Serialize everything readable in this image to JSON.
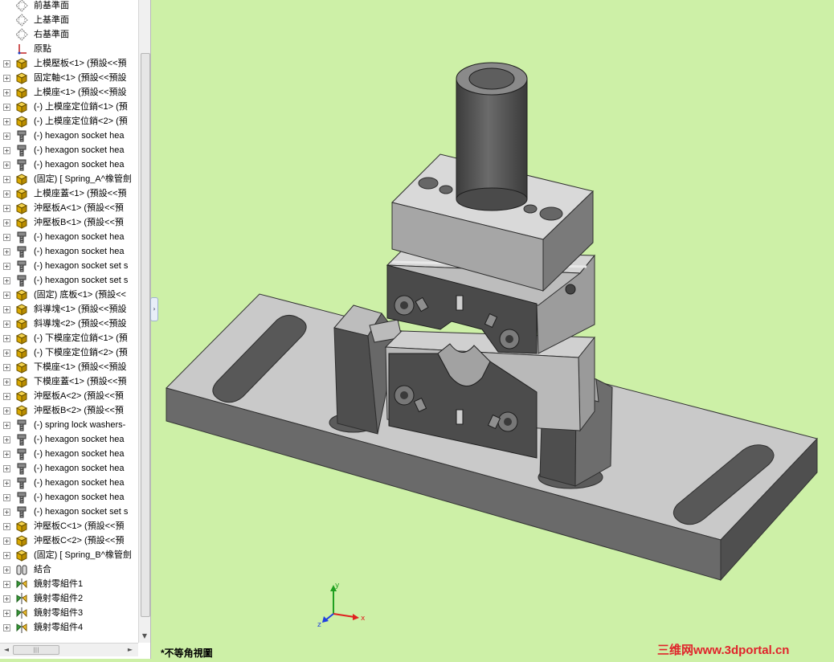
{
  "tree": {
    "items": [
      {
        "icon": "plane-icon",
        "label": "前基準面",
        "expandable": false
      },
      {
        "icon": "plane-icon",
        "label": "上基準面",
        "expandable": false
      },
      {
        "icon": "plane-icon",
        "label": "右基準面",
        "expandable": false
      },
      {
        "icon": "origin-icon",
        "label": "原點",
        "expandable": false
      },
      {
        "icon": "part-icon",
        "label": "上模壓板<1> (預設<<預",
        "expandable": true
      },
      {
        "icon": "part-icon",
        "label": "固定軸<1> (預設<<預設",
        "expandable": true
      },
      {
        "icon": "part-icon",
        "label": "上模座<1> (預設<<預設",
        "expandable": true
      },
      {
        "icon": "part-icon",
        "label": "(-) 上模座定位銷<1> (預",
        "expandable": true
      },
      {
        "icon": "part-icon",
        "label": "(-) 上模座定位銷<2> (預",
        "expandable": true
      },
      {
        "icon": "screw-icon",
        "label": "(-) hexagon socket hea",
        "expandable": true
      },
      {
        "icon": "screw-icon",
        "label": "(-) hexagon socket hea",
        "expandable": true
      },
      {
        "icon": "screw-icon",
        "label": "(-) hexagon socket hea",
        "expandable": true
      },
      {
        "icon": "part-icon",
        "label": "(固定) [ Spring_A^橡管劍",
        "expandable": true
      },
      {
        "icon": "part-icon",
        "label": "上模座蓋<1> (預設<<預",
        "expandable": true
      },
      {
        "icon": "part-icon",
        "label": "沖壓板A<1> (預設<<預",
        "expandable": true
      },
      {
        "icon": "part-icon",
        "label": "沖壓板B<1> (預設<<預",
        "expandable": true
      },
      {
        "icon": "screw-icon",
        "label": "(-) hexagon socket hea",
        "expandable": true
      },
      {
        "icon": "screw-icon",
        "label": "(-) hexagon socket hea",
        "expandable": true
      },
      {
        "icon": "screw-icon",
        "label": "(-) hexagon socket set s",
        "expandable": true
      },
      {
        "icon": "screw-icon",
        "label": "(-) hexagon socket set s",
        "expandable": true
      },
      {
        "icon": "part-icon",
        "label": "(固定) 底板<1> (預設<<",
        "expandable": true
      },
      {
        "icon": "part-icon",
        "label": "斜導塊<1> (預設<<預設",
        "expandable": true
      },
      {
        "icon": "part-icon",
        "label": "斜導塊<2> (預設<<預設",
        "expandable": true
      },
      {
        "icon": "part-icon",
        "label": "(-) 下模座定位銷<1> (預",
        "expandable": true
      },
      {
        "icon": "part-icon",
        "label": "(-) 下模座定位銷<2> (預",
        "expandable": true
      },
      {
        "icon": "part-icon",
        "label": "下模座<1> (預設<<預設",
        "expandable": true
      },
      {
        "icon": "part-icon",
        "label": "下模座蓋<1> (預設<<預",
        "expandable": true
      },
      {
        "icon": "part-icon",
        "label": "沖壓板A<2> (預設<<預",
        "expandable": true
      },
      {
        "icon": "part-icon",
        "label": "沖壓板B<2> (預設<<預",
        "expandable": true
      },
      {
        "icon": "screw-icon",
        "label": "(-) spring lock washers-",
        "expandable": true
      },
      {
        "icon": "screw-icon",
        "label": "(-) hexagon socket hea",
        "expandable": true
      },
      {
        "icon": "screw-icon",
        "label": "(-) hexagon socket hea",
        "expandable": true
      },
      {
        "icon": "screw-icon",
        "label": "(-) hexagon socket hea",
        "expandable": true
      },
      {
        "icon": "screw-icon",
        "label": "(-) hexagon socket hea",
        "expandable": true
      },
      {
        "icon": "screw-icon",
        "label": "(-) hexagon socket hea",
        "expandable": true
      },
      {
        "icon": "screw-icon",
        "label": "(-) hexagon socket set s",
        "expandable": true
      },
      {
        "icon": "part-icon",
        "label": "沖壓板C<1> (預設<<預",
        "expandable": true
      },
      {
        "icon": "part-icon",
        "label": "沖壓板C<2> (預設<<預",
        "expandable": true
      },
      {
        "icon": "part-icon",
        "label": "(固定) [ Spring_B^橡管劍",
        "expandable": true
      },
      {
        "icon": "mates-icon",
        "label": "結合",
        "expandable": true
      },
      {
        "icon": "mirror-icon",
        "label": "鏡射零組件1",
        "expandable": true
      },
      {
        "icon": "mirror-icon",
        "label": "鏡射零組件2",
        "expandable": true
      },
      {
        "icon": "mirror-icon",
        "label": "鏡射零組件3",
        "expandable": true
      },
      {
        "icon": "mirror-icon",
        "label": "鏡射零組件4",
        "expandable": true
      }
    ]
  },
  "viewport": {
    "view_name": "*不等角視圖",
    "background": "#cdf0a7",
    "triad": {
      "x": "x",
      "y": "y",
      "z": "z"
    },
    "watermark": "三维网www.3dportal.cn"
  },
  "colors": {
    "x_axis": "#e02020",
    "y_axis": "#20a020",
    "z_axis": "#2040e0",
    "part_fill": "#c8c8c8",
    "part_dark": "#5a5a5a"
  }
}
